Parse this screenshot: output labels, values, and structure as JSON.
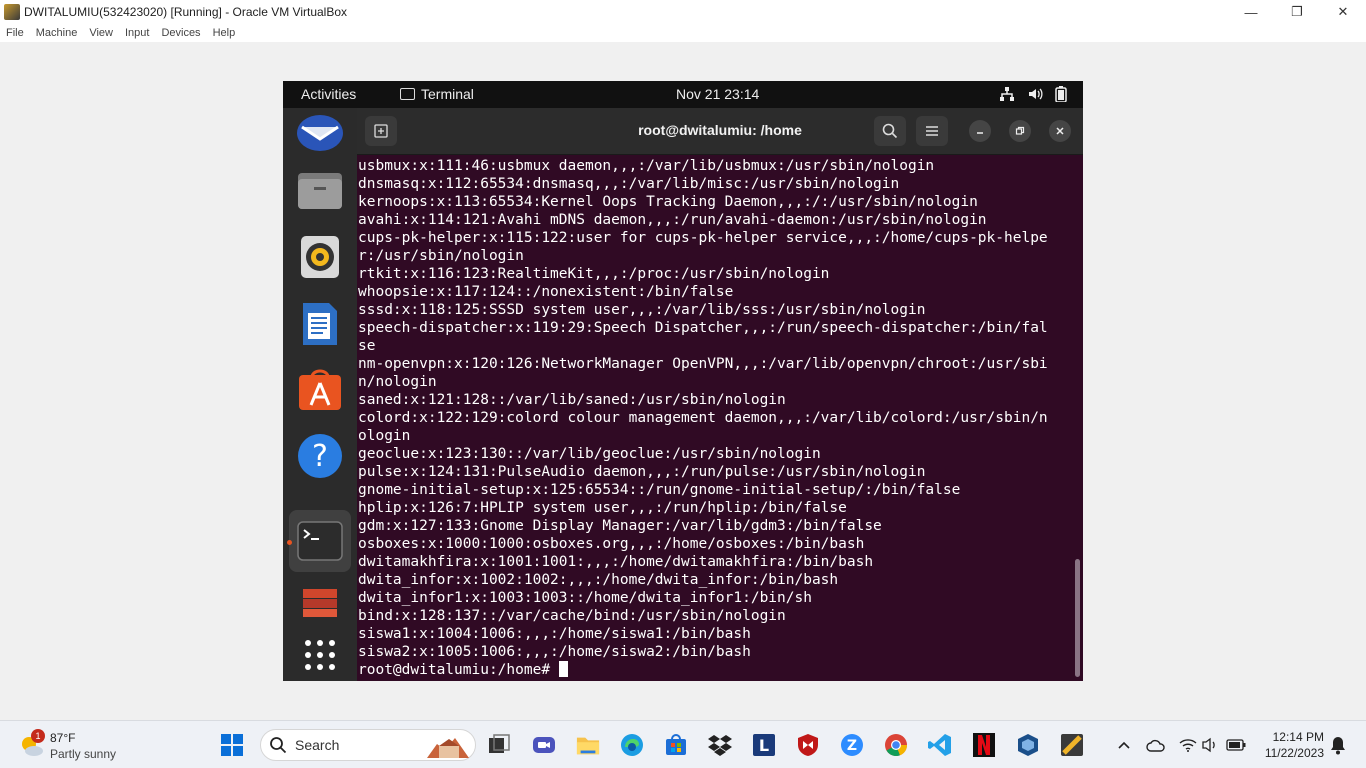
{
  "vbox": {
    "window_title": "DWITALUMIU(532423020) [Running] - Oracle VM VirtualBox",
    "menu": [
      "File",
      "Machine",
      "View",
      "Input",
      "Devices",
      "Help"
    ],
    "minimize": "—",
    "restore": "❐",
    "close": "✕"
  },
  "gnome": {
    "activities": "Activities",
    "app_name": "Terminal",
    "clock": "Nov 21  23:14",
    "tray": [
      "network-icon",
      "volume-icon",
      "battery-icon"
    ]
  },
  "dock": {
    "items": [
      {
        "name": "dock-thunderbird",
        "icon": "mail-icon"
      },
      {
        "name": "dock-files",
        "icon": "folder-icon"
      },
      {
        "name": "dock-rhythmbox",
        "icon": "speaker-icon"
      },
      {
        "name": "dock-writer",
        "icon": "document-icon"
      },
      {
        "name": "dock-software",
        "icon": "store-icon"
      },
      {
        "name": "dock-help",
        "icon": "help-icon"
      },
      {
        "name": "dock-terminal",
        "icon": "terminal-icon"
      },
      {
        "name": "dock-trash",
        "icon": "stack-icon"
      },
      {
        "name": "dock-show-apps",
        "icon": "grid-icon"
      }
    ]
  },
  "terminal": {
    "title": "root@dwitalumiu: /home",
    "lines": [
      "usbmux:x:111:46:usbmux daemon,,,:/var/lib/usbmux:/usr/sbin/nologin",
      "dnsmasq:x:112:65534:dnsmasq,,,:/var/lib/misc:/usr/sbin/nologin",
      "kernoops:x:113:65534:Kernel Oops Tracking Daemon,,,:/:/usr/sbin/nologin",
      "avahi:x:114:121:Avahi mDNS daemon,,,:/run/avahi-daemon:/usr/sbin/nologin",
      "cups-pk-helper:x:115:122:user for cups-pk-helper service,,,:/home/cups-pk-helpe",
      "r:/usr/sbin/nologin",
      "rtkit:x:116:123:RealtimeKit,,,:/proc:/usr/sbin/nologin",
      "whoopsie:x:117:124::/nonexistent:/bin/false",
      "sssd:x:118:125:SSSD system user,,,:/var/lib/sss:/usr/sbin/nologin",
      "speech-dispatcher:x:119:29:Speech Dispatcher,,,:/run/speech-dispatcher:/bin/fal",
      "se",
      "nm-openvpn:x:120:126:NetworkManager OpenVPN,,,:/var/lib/openvpn/chroot:/usr/sbi",
      "n/nologin",
      "saned:x:121:128::/var/lib/saned:/usr/sbin/nologin",
      "colord:x:122:129:colord colour management daemon,,,:/var/lib/colord:/usr/sbin/n",
      "ologin",
      "geoclue:x:123:130::/var/lib/geoclue:/usr/sbin/nologin",
      "pulse:x:124:131:PulseAudio daemon,,,:/run/pulse:/usr/sbin/nologin",
      "gnome-initial-setup:x:125:65534::/run/gnome-initial-setup/:/bin/false",
      "hplip:x:126:7:HPLIP system user,,,:/run/hplip:/bin/false",
      "gdm:x:127:133:Gnome Display Manager:/var/lib/gdm3:/bin/false",
      "osboxes:x:1000:1000:osboxes.org,,,:/home/osboxes:/bin/bash",
      "dwitamakhfira:x:1001:1001:,,,:/home/dwitamakhfira:/bin/bash",
      "dwita_infor:x:1002:1002:,,,:/home/dwita_infor:/bin/bash",
      "dwita_infor1:x:1003:1003::/home/dwita_infor1:/bin/sh",
      "bind:x:128:137::/var/cache/bind:/usr/sbin/nologin",
      "siswa1:x:1004:1006:,,,:/home/siswa1:/bin/bash",
      "siswa2:x:1005:1006:,,,:/home/siswa2:/bin/bash"
    ],
    "prompt": "root@dwitalumiu:/home# "
  },
  "taskbar": {
    "weather_badge": "1",
    "weather_temp": "87°F",
    "weather_cond": "Partly sunny",
    "search_label": "Search",
    "time": "12:14 PM",
    "date": "11/22/2023"
  }
}
